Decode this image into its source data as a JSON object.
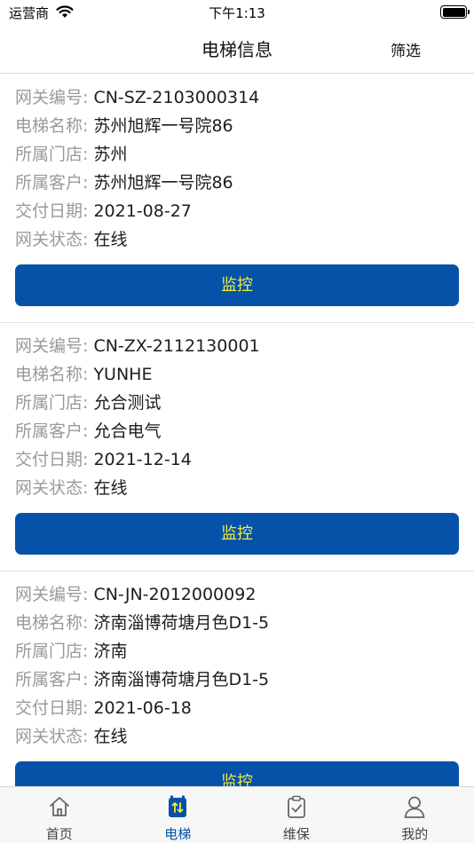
{
  "status_bar": {
    "carrier": "运营商",
    "time": "下午1:13"
  },
  "nav": {
    "title": "电梯信息",
    "filter_label": "筛选"
  },
  "cards": [
    {
      "fields": [
        {
          "label": "网关编号:",
          "value": "CN-SZ-2103000314"
        },
        {
          "label": "电梯名称:",
          "value": "苏州旭辉一号院86"
        },
        {
          "label": "所属门店:",
          "value": "苏州"
        },
        {
          "label": "所属客户:",
          "value": "苏州旭辉一号院86"
        },
        {
          "label": "交付日期:",
          "value": "2021-08-27"
        },
        {
          "label": "网关状态:",
          "value": "在线"
        }
      ],
      "button_label": "监控"
    },
    {
      "fields": [
        {
          "label": "网关编号:",
          "value": "CN-ZX-2112130001"
        },
        {
          "label": "电梯名称:",
          "value": "YUNHE"
        },
        {
          "label": "所属门店:",
          "value": "允合测试"
        },
        {
          "label": "所属客户:",
          "value": "允合电气"
        },
        {
          "label": "交付日期:",
          "value": "2021-12-14"
        },
        {
          "label": "网关状态:",
          "value": "在线"
        }
      ],
      "button_label": "监控"
    },
    {
      "fields": [
        {
          "label": "网关编号:",
          "value": "CN-JN-2012000092"
        },
        {
          "label": "电梯名称:",
          "value": "济南淄博荷塘月色D1-5"
        },
        {
          "label": "所属门店:",
          "value": "济南"
        },
        {
          "label": "所属客户:",
          "value": "济南淄博荷塘月色D1-5"
        },
        {
          "label": "交付日期:",
          "value": "2021-06-18"
        },
        {
          "label": "网关状态:",
          "value": "在线"
        }
      ],
      "button_label": "监控"
    }
  ],
  "tabs": [
    {
      "label": "首页",
      "icon": "home-icon",
      "active": false
    },
    {
      "label": "电梯",
      "icon": "elevator-icon",
      "active": true
    },
    {
      "label": "维保",
      "icon": "clipboard-check-icon",
      "active": false
    },
    {
      "label": "我的",
      "icon": "user-icon",
      "active": false
    }
  ],
  "colors": {
    "primary": "#0652a8",
    "button_text": "#f2ea3a",
    "label_gray": "#9a9a9a"
  }
}
